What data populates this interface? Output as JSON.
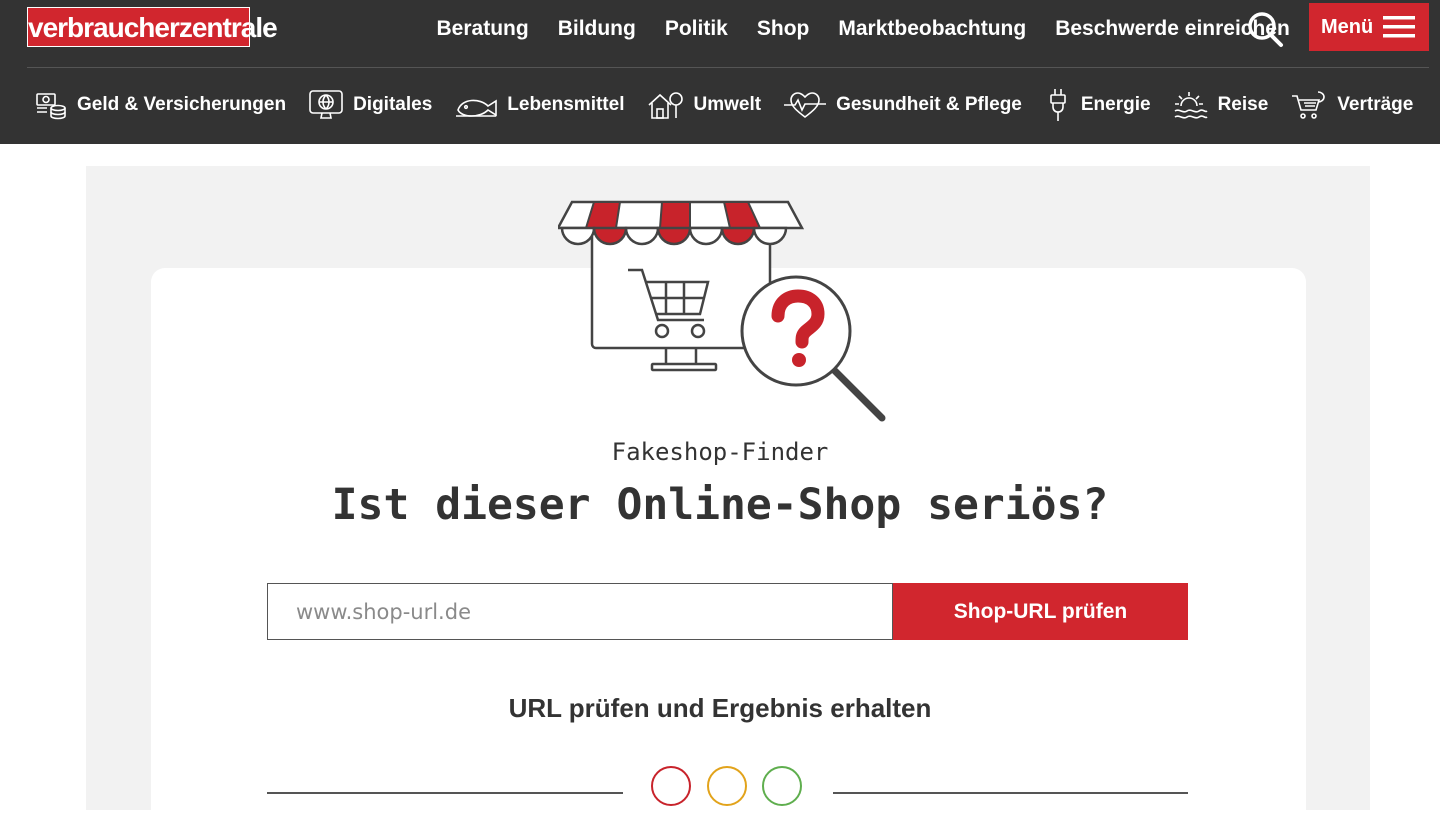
{
  "logo": {
    "text": "verbraucherzentrale"
  },
  "topnav": {
    "items": [
      "Beratung",
      "Bildung",
      "Politik",
      "Shop",
      "Marktbeobachtung",
      "Beschwerde einreichen"
    ],
    "search_icon": "search-icon",
    "menu_label": "Menü",
    "menu_icon": "hamburger-icon"
  },
  "catnav": {
    "items": [
      {
        "label": "Geld & Versicherungen",
        "icon": "money-coins-icon"
      },
      {
        "label": "Digitales",
        "icon": "monitor-globe-icon"
      },
      {
        "label": "Lebensmittel",
        "icon": "fish-plate-icon"
      },
      {
        "label": "Umwelt",
        "icon": "house-tree-icon"
      },
      {
        "label": "Gesundheit & Pflege",
        "icon": "heartbeat-icon"
      },
      {
        "label": "Energie",
        "icon": "plug-icon"
      },
      {
        "label": "Reise",
        "icon": "sun-wave-icon"
      },
      {
        "label": "Verträge",
        "icon": "cart-contract-icon"
      }
    ]
  },
  "main": {
    "illustration_icon": "shop-magnifier-question-icon",
    "eyebrow": "Fakeshop-Finder",
    "headline": "Ist dieser Online-Shop seriös?",
    "url_input": {
      "placeholder": "www.shop-url.de",
      "value": ""
    },
    "check_button": "Shop-URL prüfen",
    "subhead": "URL prüfen und Ergebnis erhalten",
    "status_circles": [
      {
        "name": "red-status-circle",
        "color": "#c8232b"
      },
      {
        "name": "yellow-status-circle",
        "color": "#e2a31b"
      },
      {
        "name": "green-status-circle",
        "color": "#5fae4e"
      }
    ]
  },
  "colors": {
    "brand_red": "#d1262e",
    "header_bg": "#333333",
    "page_bg": "#f2f2f2"
  }
}
